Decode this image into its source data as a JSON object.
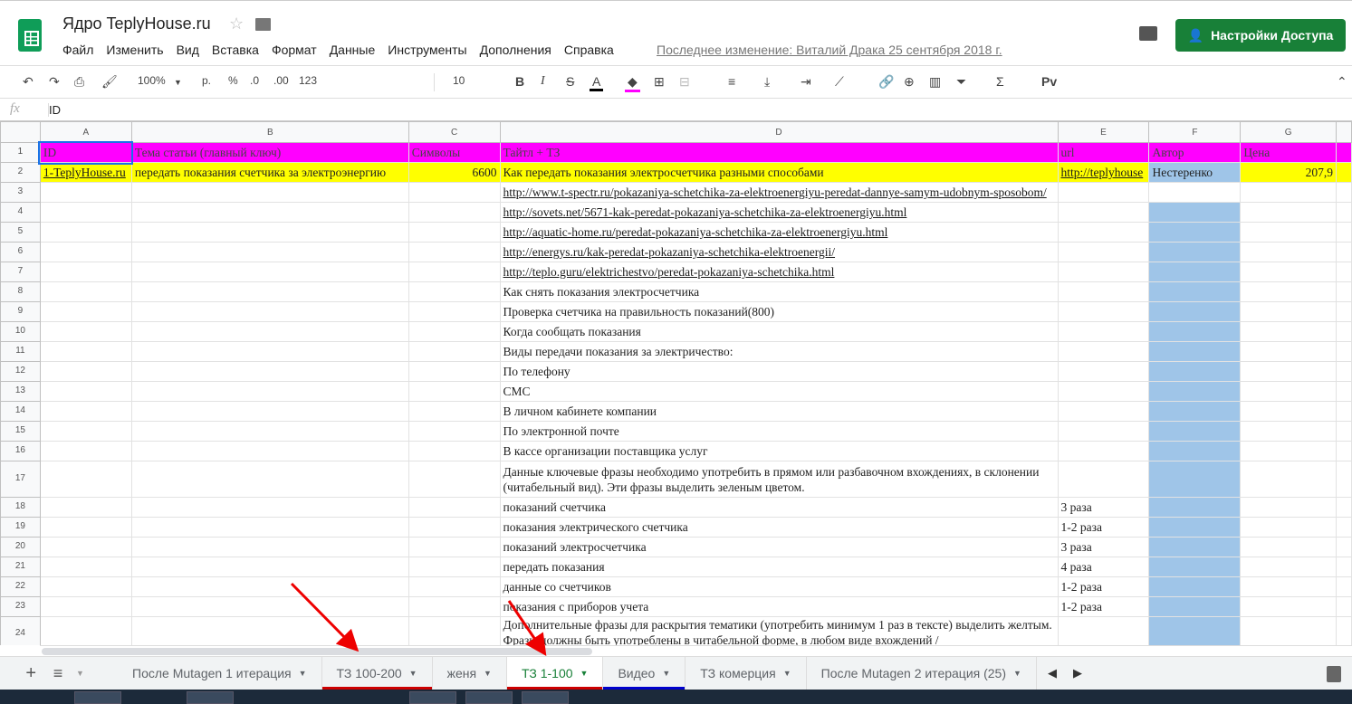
{
  "header": {
    "title": "Ядро TeplyHouse.ru",
    "menu": [
      "Файл",
      "Изменить",
      "Вид",
      "Вставка",
      "Формат",
      "Данные",
      "Инструменты",
      "Дополнения",
      "Справка"
    ],
    "last_edit": "Последнее изменение: Виталий Драка 25 сентября 2018 г.",
    "share_label": "Настройки Доступа"
  },
  "toolbar": {
    "zoom": "100%",
    "currency": "р.",
    "percent": "%",
    "dec_less": ".0",
    "dec_more": ".00",
    "format": "123",
    "font_size": "10"
  },
  "formula": {
    "fx": "fx",
    "value": "ID"
  },
  "columns": [
    "A",
    "B",
    "C",
    "D",
    "E",
    "F",
    "G"
  ],
  "rows": [
    {
      "n": "1",
      "cells": [
        "ID",
        "Тема статьи (главный ключ)",
        "Символы",
        "Тайтл + ТЗ",
        "url",
        "Автор",
        "Цена"
      ]
    },
    {
      "n": "2",
      "cells": [
        "1-TeplyHouse.ru",
        "передать показания счетчика за электроэнергию",
        "6600",
        "Как передать показания электросчетчика разными способами",
        "http://teplyhouse",
        "Нестеренко",
        "207,9"
      ]
    },
    {
      "n": "3",
      "cells": [
        "",
        "",
        "",
        "http://www.t-spectr.ru/pokazaniya-schetchika-za-elektroenergiyu-peredat-dannye-samym-udobnym-sposobom/",
        "",
        "",
        ""
      ]
    },
    {
      "n": "4",
      "cells": [
        "",
        "",
        "",
        "http://sovets.net/5671-kak-peredat-pokazaniya-schetchika-za-elektroenergiyu.html",
        "",
        "",
        ""
      ]
    },
    {
      "n": "5",
      "cells": [
        "",
        "",
        "",
        "http://aquatic-home.ru/peredat-pokazaniya-schetchika-za-elektroenergiyu.html",
        "",
        "",
        ""
      ]
    },
    {
      "n": "6",
      "cells": [
        "",
        "",
        "",
        "http://energys.ru/kak-peredat-pokazaniya-schetchika-elektroenergii/",
        "",
        "",
        ""
      ]
    },
    {
      "n": "7",
      "cells": [
        "",
        "",
        "",
        "http://teplo.guru/elektrichestvo/peredat-pokazaniya-schetchika.html",
        "",
        "",
        ""
      ]
    },
    {
      "n": "8",
      "cells": [
        "",
        "",
        "",
        "Как снять показания электросчетчика",
        "",
        "",
        ""
      ]
    },
    {
      "n": "9",
      "cells": [
        "",
        "",
        "",
        "Проверка счетчика на правильность показаний(800)",
        "",
        "",
        ""
      ]
    },
    {
      "n": "10",
      "cells": [
        "",
        "",
        "",
        "Когда сообщать показания",
        "",
        "",
        ""
      ]
    },
    {
      "n": "11",
      "cells": [
        "",
        "",
        "",
        "Виды передачи показания за электричество:",
        "",
        "",
        ""
      ]
    },
    {
      "n": "12",
      "cells": [
        "",
        "",
        "",
        "По телефону",
        "",
        "",
        ""
      ]
    },
    {
      "n": "13",
      "cells": [
        "",
        "",
        "",
        "СМС",
        "",
        "",
        ""
      ]
    },
    {
      "n": "14",
      "cells": [
        "",
        "",
        "",
        "В личном кабинете компании",
        "",
        "",
        ""
      ]
    },
    {
      "n": "15",
      "cells": [
        "",
        "",
        "",
        "По электронной почте",
        "",
        "",
        ""
      ]
    },
    {
      "n": "16",
      "cells": [
        "",
        "",
        "",
        "В кассе организации поставщика услуг",
        "",
        "",
        ""
      ]
    },
    {
      "n": "17",
      "cells": [
        "",
        "",
        "",
        "Данные ключевые фразы необходимо употребить в прямом или разбавочном вхождениях, в склонении (читабельный вид). Эти фразы выделить зеленым цветом.",
        "",
        "",
        ""
      ]
    },
    {
      "n": "18",
      "cells": [
        "",
        "",
        "",
        "показаний счетчика",
        "3 раза",
        "",
        ""
      ]
    },
    {
      "n": "19",
      "cells": [
        "",
        "",
        "",
        "показания электрического счетчика",
        "1-2 раза",
        "",
        ""
      ]
    },
    {
      "n": "20",
      "cells": [
        "",
        "",
        "",
        "показаний электросчетчика",
        "3 раза",
        "",
        ""
      ]
    },
    {
      "n": "21",
      "cells": [
        "",
        "",
        "",
        "передать показания",
        "4 раза",
        "",
        ""
      ]
    },
    {
      "n": "22",
      "cells": [
        "",
        "",
        "",
        "данные со счетчиков",
        "1-2 раза",
        "",
        ""
      ]
    },
    {
      "n": "23",
      "cells": [
        "",
        "",
        "",
        "показания с приборов учета",
        "1-2 раза",
        "",
        ""
      ]
    },
    {
      "n": "24",
      "cells": [
        "",
        "",
        "",
        "Дополнительные фразы для раскрытия тематики (употребить минимум 1 раз в тексте) выделить желтым. Фразы должны быть употреблены в читабельной форме, в любом виде вхождений /",
        "",
        "",
        ""
      ]
    }
  ],
  "tabs": [
    {
      "label": "После Mutagen 1 итерация",
      "active": false,
      "underline": ""
    },
    {
      "label": "ТЗ 100-200",
      "active": false,
      "underline": "#cc0000"
    },
    {
      "label": "женя",
      "active": false,
      "underline": ""
    },
    {
      "label": "ТЗ 1-100",
      "active": true,
      "underline": "#cc0000"
    },
    {
      "label": "Видео",
      "active": false,
      "underline": "#0000cc"
    },
    {
      "label": "ТЗ комерция",
      "active": false,
      "underline": ""
    },
    {
      "label": "После Mutagen 2 итерация (25)",
      "active": false,
      "underline": ""
    }
  ]
}
